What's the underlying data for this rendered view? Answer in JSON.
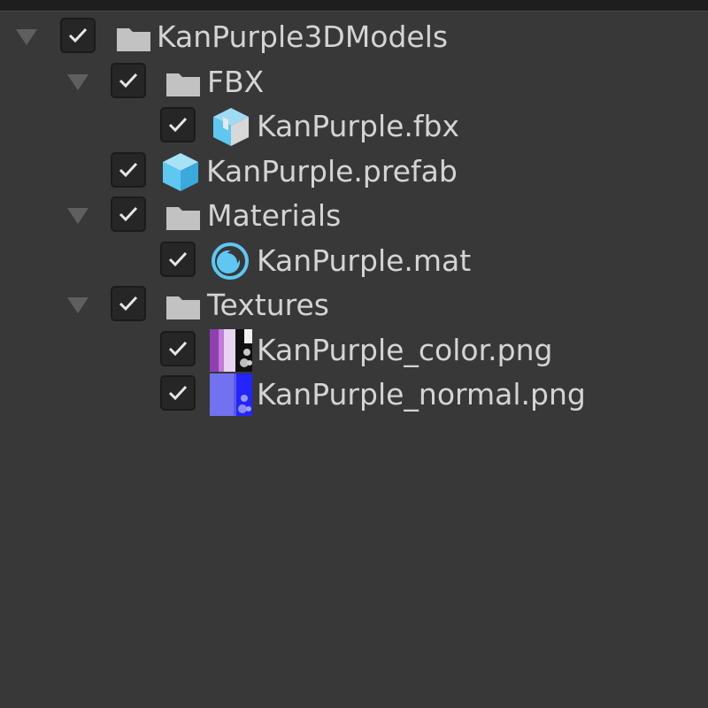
{
  "project_tree": {
    "root": {
      "label": "KanPurple3DModels",
      "checked": true,
      "expanded": true,
      "icon": "folder-icon"
    },
    "fbx_folder": {
      "label": "FBX",
      "checked": true,
      "expanded": true,
      "icon": "folder-icon"
    },
    "fbx_file": {
      "label": "KanPurple.fbx",
      "checked": true,
      "icon": "model-icon"
    },
    "prefab_file": {
      "label": "KanPurple.prefab",
      "checked": true,
      "icon": "prefab-icon"
    },
    "materials_folder": {
      "label": "Materials",
      "checked": true,
      "expanded": true,
      "icon": "folder-icon"
    },
    "mat_file": {
      "label": "KanPurple.mat",
      "checked": true,
      "icon": "material-icon"
    },
    "textures_folder": {
      "label": "Textures",
      "checked": true,
      "expanded": true,
      "icon": "folder-icon"
    },
    "color_texture": {
      "label": "KanPurple_color.png",
      "checked": true,
      "icon": "texture-thumbnail-icon"
    },
    "normal_texture": {
      "label": "KanPurple_normal.png",
      "checked": true,
      "icon": "texture-thumbnail-icon"
    }
  },
  "colors": {
    "background": "#383838",
    "text": "#d4d4d4",
    "checkbox_bg": "#262626",
    "asset_icon_blue": "#5ec8f2"
  }
}
